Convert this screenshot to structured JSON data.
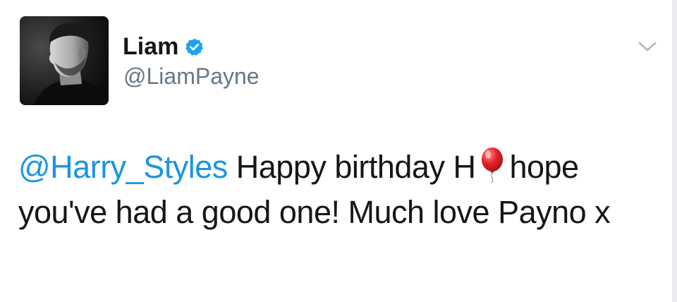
{
  "user": {
    "display_name": "Liam",
    "handle": "@LiamPayne",
    "verified": true,
    "avatar_icon": "profile-photo"
  },
  "tweet": {
    "mention": "@Harry_Styles",
    "text_part1": "Happy birthday H",
    "emoji": "balloon-emoji",
    "text_part2": "hope you've had a good one! Much love Payno x"
  },
  "icons": {
    "verified": "verified-badge-icon",
    "menu": "chevron-down-icon"
  },
  "colors": {
    "mention": "#1b95e0",
    "handle": "#657786",
    "verified_badge": "#1da1f2",
    "text": "#14171a"
  }
}
